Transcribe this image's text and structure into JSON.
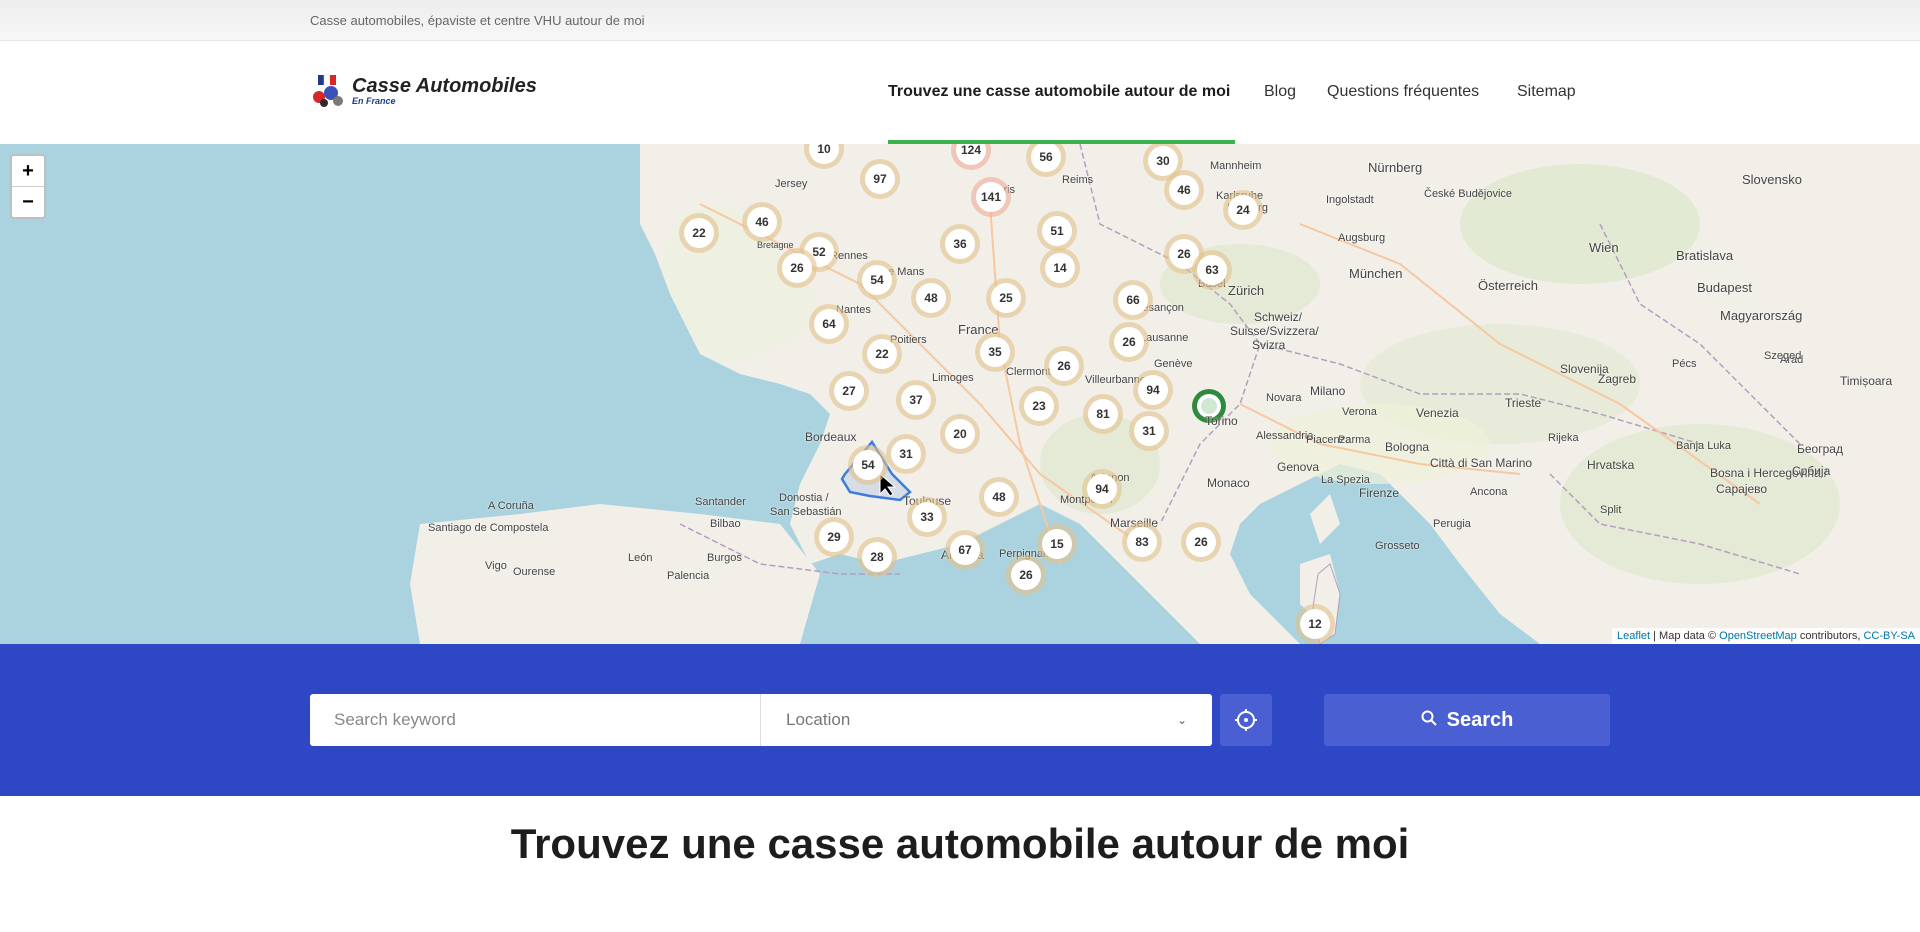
{
  "topbar": {
    "tagline": "Casse automobiles, épaviste et centre VHU autour de moi"
  },
  "logo": {
    "title": "Casse Automobiles",
    "subtitle": "En France",
    "icon": "car-logo-icon"
  },
  "nav": {
    "items": [
      {
        "label": "Trouvez une casse automobile autour de moi",
        "active": true
      },
      {
        "label": "Blog"
      },
      {
        "label": "Questions fréquentes"
      },
      {
        "label": "Sitemap"
      }
    ]
  },
  "map": {
    "zoom_in": "+",
    "zoom_out": "−",
    "attribution": {
      "leaflet": "Leaflet",
      "text1": " | Map data © ",
      "osm": "OpenStreetMap",
      "text2": " contributors, ",
      "license": "CC-BY-SA"
    },
    "labels": {
      "jersey": "Jersey",
      "paris": "Paris",
      "reims": "Reims",
      "nurnberg": "Nürnberg",
      "mannheim": "Mannheim",
      "karlsruhe": "Karlsruhe",
      "ingolstadt": "Ingolstadt",
      "augsburg": "Augsburg",
      "munchen": "München",
      "wien": "Wien",
      "bratislava": "Bratislava",
      "budapest": "Budapest",
      "zurich": "Zürich",
      "schweiz": "Schweiz/",
      "suisse": "Suisse/Svizzera/",
      "svizra": "Svizra",
      "lausanne": "Lausanne",
      "geneve": "Genève",
      "besancon": "Besançon",
      "lemans": "Le Mans",
      "poitiers": "Poitiers",
      "limoges": "Limoges",
      "france": "France",
      "clermont": "Clermont",
      "lyon": "Villeurbanne",
      "bordeaux": "Bordeaux",
      "toulouse": "Toulouse",
      "marseille": "Marseille",
      "monaco": "Monaco",
      "genova": "Genova",
      "milano": "Milano",
      "torino": "Torino",
      "venezia": "Venezia",
      "verona": "Verona",
      "bologna": "Bologna",
      "firenze": "Firenze",
      "sanmarino": "Città di San Marino",
      "trieste": "Trieste",
      "slovenija": "Slovenija",
      "zagreb": "Zagreb",
      "hrvatska": "Hrvatska",
      "bosna": "Bosna i Hercegovina /",
      "srbija": "Србија",
      "andorra": "Andorra",
      "perpignan": "Perpignan",
      "donostia": "Donostia /",
      "sansebastian": "San Sebastián",
      "bilbao": "Bilbao",
      "santander": "Santander",
      "acoruna": "A Coruña",
      "leon": "León",
      "burgos": "Burgos",
      "palencia": "Palencia",
      "vigo": "Vigo",
      "ourense": "Ourense",
      "avignon": "Avignon",
      "montpellier": "Montpellier",
      "osterreich": "Österreich",
      "magyarorszag": "Magyarország",
      "slovensko": "Slovensko",
      "ceske": "České Budějovice",
      "rijeka": "Rijeka",
      "sarajevo": "Сарајево",
      "beograd": "Београд",
      "timisoara": "Timișoara",
      "arad": "Arad",
      "szeged": "Szeged",
      "pecs": "Pécs",
      "banjaluka": "Banja Luka",
      "split": "Split",
      "ancona": "Ancona",
      "perugia": "Perugia",
      "grosseto": "Grosseto",
      "lacspezia": "La Spezia",
      "alessandria": "Alessandria",
      "parma": "Parma",
      "piacenza": "Piacenza",
      "novara": "Novara",
      "freiburg": "Freiburg",
      "basel": "Basel",
      "rennes": "Rennes",
      "bretagne": "Bretagne",
      "nantes": "Nantes",
      "santiago": "Santiago de Compostela"
    },
    "clusters": [
      {
        "n": "10"
      },
      {
        "n": "124",
        "red": true
      },
      {
        "n": "56"
      },
      {
        "n": "30"
      },
      {
        "n": "97"
      },
      {
        "n": "141",
        "red": true
      },
      {
        "n": "46"
      },
      {
        "n": "24"
      },
      {
        "n": "22"
      },
      {
        "n": "46"
      },
      {
        "n": "51"
      },
      {
        "n": "52"
      },
      {
        "n": "36"
      },
      {
        "n": "26"
      },
      {
        "n": "26"
      },
      {
        "n": "63"
      },
      {
        "n": "14"
      },
      {
        "n": "54"
      },
      {
        "n": "48"
      },
      {
        "n": "25"
      },
      {
        "n": "66"
      },
      {
        "n": "64"
      },
      {
        "n": "26"
      },
      {
        "n": "22"
      },
      {
        "n": "35"
      },
      {
        "n": "26"
      },
      {
        "n": "94"
      },
      {
        "n": "27"
      },
      {
        "n": "37"
      },
      {
        "n": "23"
      },
      {
        "n": "81"
      },
      {
        "n": "31"
      },
      {
        "n": "20"
      },
      {
        "n": "31"
      },
      {
        "n": "54"
      },
      {
        "n": "94"
      },
      {
        "n": "48"
      },
      {
        "n": "33"
      },
      {
        "n": "29"
      },
      {
        "n": "67"
      },
      {
        "n": "15"
      },
      {
        "n": "83"
      },
      {
        "n": "26"
      },
      {
        "n": "28"
      },
      {
        "n": "26"
      },
      {
        "n": "12"
      }
    ]
  },
  "search": {
    "keyword_placeholder": "Search keyword",
    "location_value": "Location",
    "button_label": "Search"
  },
  "main": {
    "title": "Trouvez une casse automobile autour de moi"
  },
  "colors": {
    "brand_blue": "#2e47c4",
    "button_blue": "#4a5fd1",
    "nav_underline": "#3cb44b",
    "sea": "#aad3df",
    "land": "#f2efe9"
  }
}
